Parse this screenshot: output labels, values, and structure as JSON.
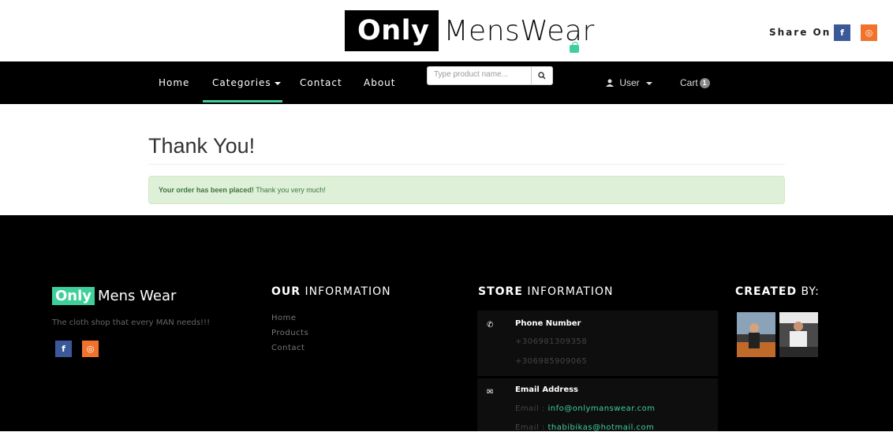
{
  "header": {
    "logo_bold": "Only",
    "logo_rest": "MensWear",
    "share_label": "Share On :",
    "social": {
      "facebook": "f",
      "instagram": "◎"
    }
  },
  "nav": {
    "home": "Home",
    "categories": "Categories",
    "contact": "Contact",
    "about": "About",
    "search_placeholder": "Type product name...",
    "user": "User",
    "cart": "Cart",
    "cart_count": "1"
  },
  "main": {
    "title": "Thank You!",
    "alert_strong": "Your order has been placed!",
    "alert_rest": " Thank you very much!"
  },
  "footer": {
    "brand_bold": "Only",
    "brand_rest": "Mens Wear",
    "tagline": "The cloth shop that every MAN needs!!!",
    "our_info_bold": "OUR",
    "our_info_rest": " INFORMATION",
    "links": [
      "Home",
      "Products",
      "Contact"
    ],
    "store_info_bold": "STORE",
    "store_info_rest": " INFORMATION",
    "phone_title": "Phone Number",
    "phones": [
      "+306981309358",
      "+306985909065"
    ],
    "email_title": "Email Address",
    "email_prefix": "Email : ",
    "emails": [
      "info@onlymanswear.com",
      "thabibikas@hotmail.com"
    ],
    "created_bold": "CREATED",
    "created_rest": " BY:"
  },
  "colors": {
    "accent": "#3ecf9a",
    "facebook": "#3b5998",
    "instagram": "#f1722b",
    "alert_bg": "#dff0d8",
    "alert_text": "#3c763d"
  }
}
